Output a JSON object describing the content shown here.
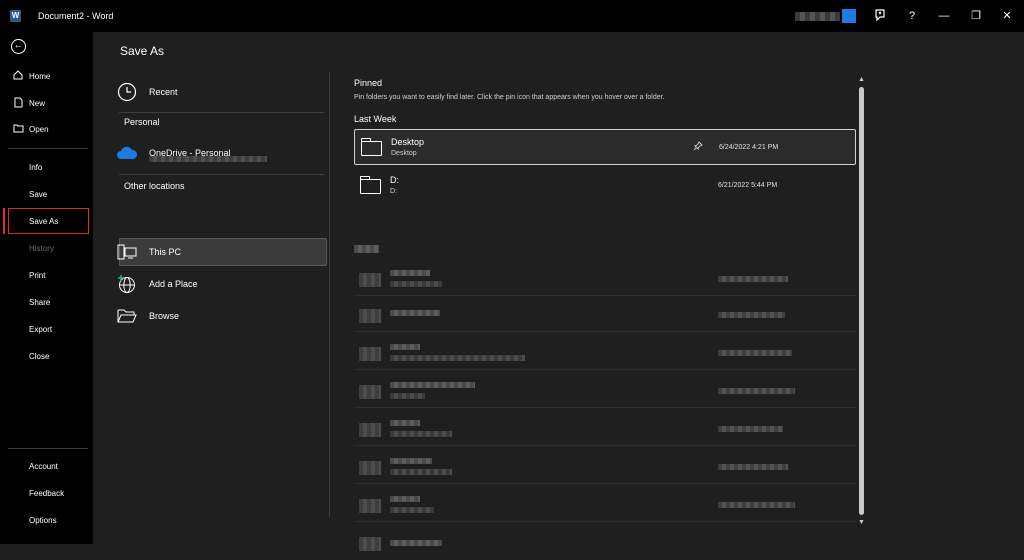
{
  "titlebar": {
    "title": "Document2  -  Word",
    "help_label": "?",
    "minimize_label": "—",
    "restore_label": "❐",
    "close_label": "✕",
    "accent_color": "#1e7be0"
  },
  "leftnav": {
    "back_label": "←",
    "top_items": [
      {
        "label": "Home",
        "icon": "home-icon"
      },
      {
        "label": "New",
        "icon": "new-document-icon"
      },
      {
        "label": "Open",
        "icon": "open-folder-icon"
      }
    ],
    "middle_items": [
      {
        "label": "Info",
        "enabled": true
      },
      {
        "label": "Save",
        "enabled": true
      },
      {
        "label": "Save As",
        "enabled": true,
        "selected": true
      },
      {
        "label": "History",
        "enabled": false
      },
      {
        "label": "Print",
        "enabled": true
      },
      {
        "label": "Share",
        "enabled": true
      },
      {
        "label": "Export",
        "enabled": true
      },
      {
        "label": "Close",
        "enabled": true
      }
    ],
    "bottom_items": [
      {
        "label": "Account"
      },
      {
        "label": "Feedback"
      },
      {
        "label": "Options"
      }
    ],
    "selection_color": "#d92b2b"
  },
  "main": {
    "title": "Save As",
    "locations": {
      "recent": "Recent",
      "personal_header": "Personal",
      "onedrive": "OneDrive - Personal",
      "other_header": "Other locations",
      "this_pc": "This PC",
      "add_place": "Add a Place",
      "browse": "Browse"
    },
    "pinned": {
      "header": "Pinned",
      "description": "Pin folders you want to easily find later. Click the pin icon that appears when you hover over a folder."
    },
    "last_week": {
      "header": "Last Week",
      "folders": [
        {
          "name": "Desktop",
          "path": "Desktop",
          "date": "6/24/2022 4:21 PM",
          "selected": true
        },
        {
          "name": "D:",
          "path": "D:",
          "date": "6/21/2022 5:44 PM",
          "selected": false
        }
      ]
    }
  }
}
